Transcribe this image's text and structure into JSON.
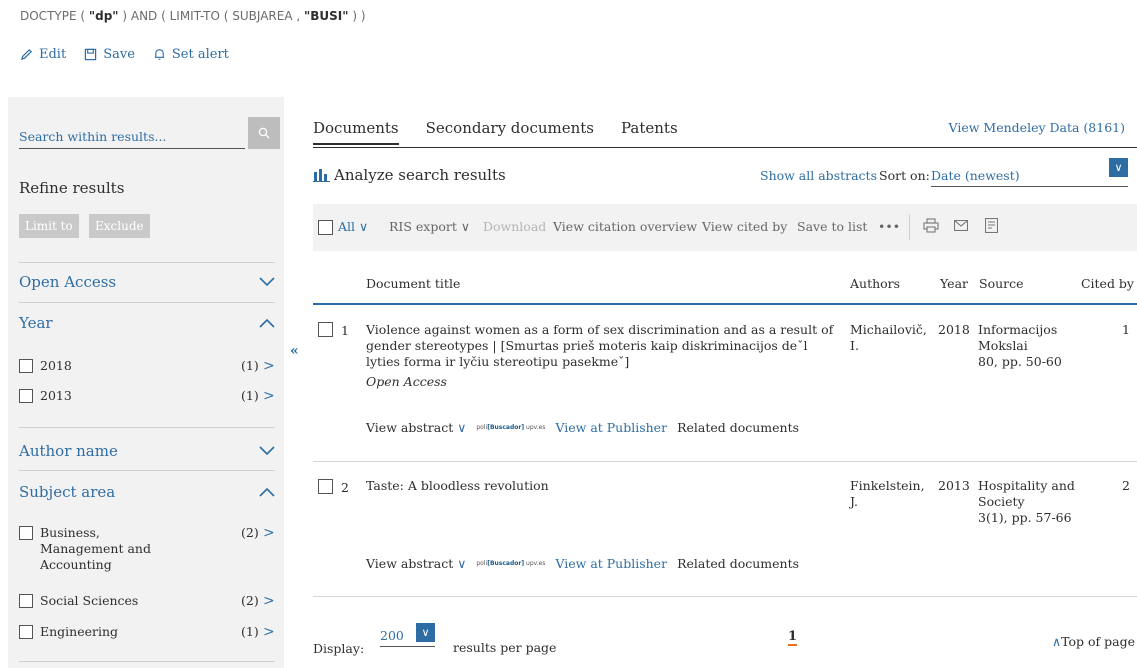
{
  "query": {
    "prefix": "DOCTYPE ( ",
    "doctype_value": "\"dp\"",
    "middle": " ) AND ( LIMIT-TO ( SUBJAREA , ",
    "subject_value": "\"BUSI\"",
    "suffix": " ) )"
  },
  "top_actions": {
    "edit": "Edit",
    "save": "Save",
    "set_alert": "Set alert"
  },
  "sidebar": {
    "search_placeholder": "Search within results...",
    "refine_title": "Refine results",
    "limit_to": "Limit to",
    "exclude": "Exclude",
    "facets": {
      "open_access": "Open Access",
      "year": "Year",
      "author_name": "Author name",
      "subject_area": "Subject area"
    },
    "year_items": [
      {
        "label": "2018",
        "count": "(1)"
      },
      {
        "label": "2013",
        "count": "(1)"
      }
    ],
    "subject_items": [
      {
        "label": "Business, Management and Accounting",
        "count": "(2)"
      },
      {
        "label": "Social Sciences",
        "count": "(2)"
      },
      {
        "label": "Engineering",
        "count": "(1)"
      }
    ]
  },
  "main": {
    "tabs": [
      "Documents",
      "Secondary documents",
      "Patents"
    ],
    "mendeley": "View Mendeley Data (8161)",
    "analyze": "Analyze search results",
    "show_all_abstracts": "Show all abstracts",
    "sort_on": "Sort on:",
    "sort_value": "Date (newest)",
    "toolbar": {
      "all": "All",
      "ris_export": "RIS export",
      "download": "Download",
      "view_citation_overview": "View citation overview",
      "view_cited_by": "View cited by",
      "save_to_list": "Save to list",
      "more": "•••"
    },
    "columns": {
      "title": "Document title",
      "authors": "Authors",
      "year": "Year",
      "source": "Source",
      "cited_by": "Cited by"
    },
    "rows": [
      {
        "num": "1",
        "title": "Violence against women as a form of sex discrimination and as a result of gender stereotypes | [Smurtas prieš moteris kaip diskriminacijos deˇl lyties forma ir lyčiu stereotipu pasekmeˇ]",
        "open_access": "Open Access",
        "authors": "Michailovič, I.",
        "year": "2018",
        "source": "Informacijos Mokslai",
        "source_detail": "80, pp. 50-60",
        "cited": "1"
      },
      {
        "num": "2",
        "title": "Taste: A bloodless revolution",
        "open_access": "",
        "authors": "Finkelstein, J.",
        "year": "2013",
        "source": "Hospitality and Society",
        "source_detail": "3(1), pp. 57-66",
        "cited": "2"
      }
    ],
    "row_actions": {
      "view_abstract": "View abstract",
      "logo_prefix": "poli",
      "logo_middle": "[Buscador]",
      "logo_suffix": "upv.es",
      "view_at_publisher": "View at Publisher",
      "related_documents": "Related documents"
    },
    "footer": {
      "display": "Display:",
      "per_page_value": "200",
      "results_per_page": "results per page",
      "page": "1",
      "top_of_page": "Top of page"
    }
  },
  "colors": {
    "link": "#2e6da4",
    "sidebar_bg": "#f2f2f2",
    "accent_underline": "#e9711c"
  }
}
